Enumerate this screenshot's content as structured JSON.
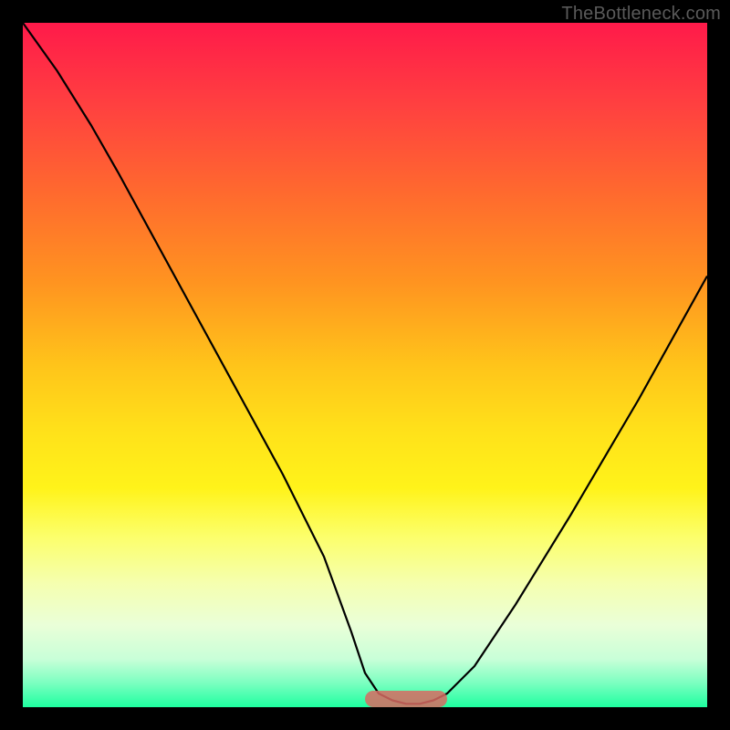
{
  "watermark": "TheBottleneck.com",
  "chart_data": {
    "type": "line",
    "title": "",
    "xlabel": "",
    "ylabel": "",
    "xlim": [
      0,
      100
    ],
    "ylim": [
      0,
      100
    ],
    "series": [
      {
        "name": "bottleneck-curve",
        "x": [
          0,
          5,
          10,
          14,
          20,
          26,
          32,
          38,
          44,
          48,
          50,
          52,
          54,
          56,
          58,
          60,
          62,
          66,
          72,
          80,
          90,
          100
        ],
        "values": [
          100,
          93,
          85,
          78,
          67,
          56,
          45,
          34,
          22,
          11,
          5,
          2,
          1,
          0.5,
          0.5,
          1,
          2,
          6,
          15,
          28,
          45,
          63
        ]
      }
    ],
    "annotations": [
      {
        "name": "optimal-range-marker",
        "x_start": 50,
        "x_end": 62,
        "y": 0,
        "color": "#d86a62"
      }
    ],
    "background_gradient": {
      "top": "#ff1a4a",
      "mid": "#ffe21a",
      "bottom": "#1effa0"
    }
  }
}
